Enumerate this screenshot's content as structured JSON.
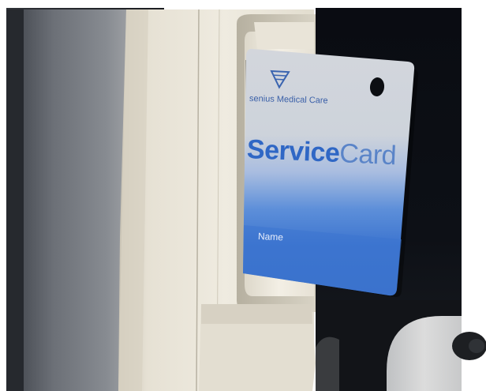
{
  "card": {
    "brand_text": "senius Medical Care",
    "title_bold": "Service",
    "title_light": "Card",
    "name_label": "Name"
  },
  "colors": {
    "card_blue": "#2f6fcf",
    "card_gray": "#d6d9de",
    "device_cream": "#ece7db",
    "background_dark": "#0b0d12"
  },
  "icons": {
    "logo": "fresenius-triangle-logo-icon",
    "hole": "card-punch-hole"
  }
}
